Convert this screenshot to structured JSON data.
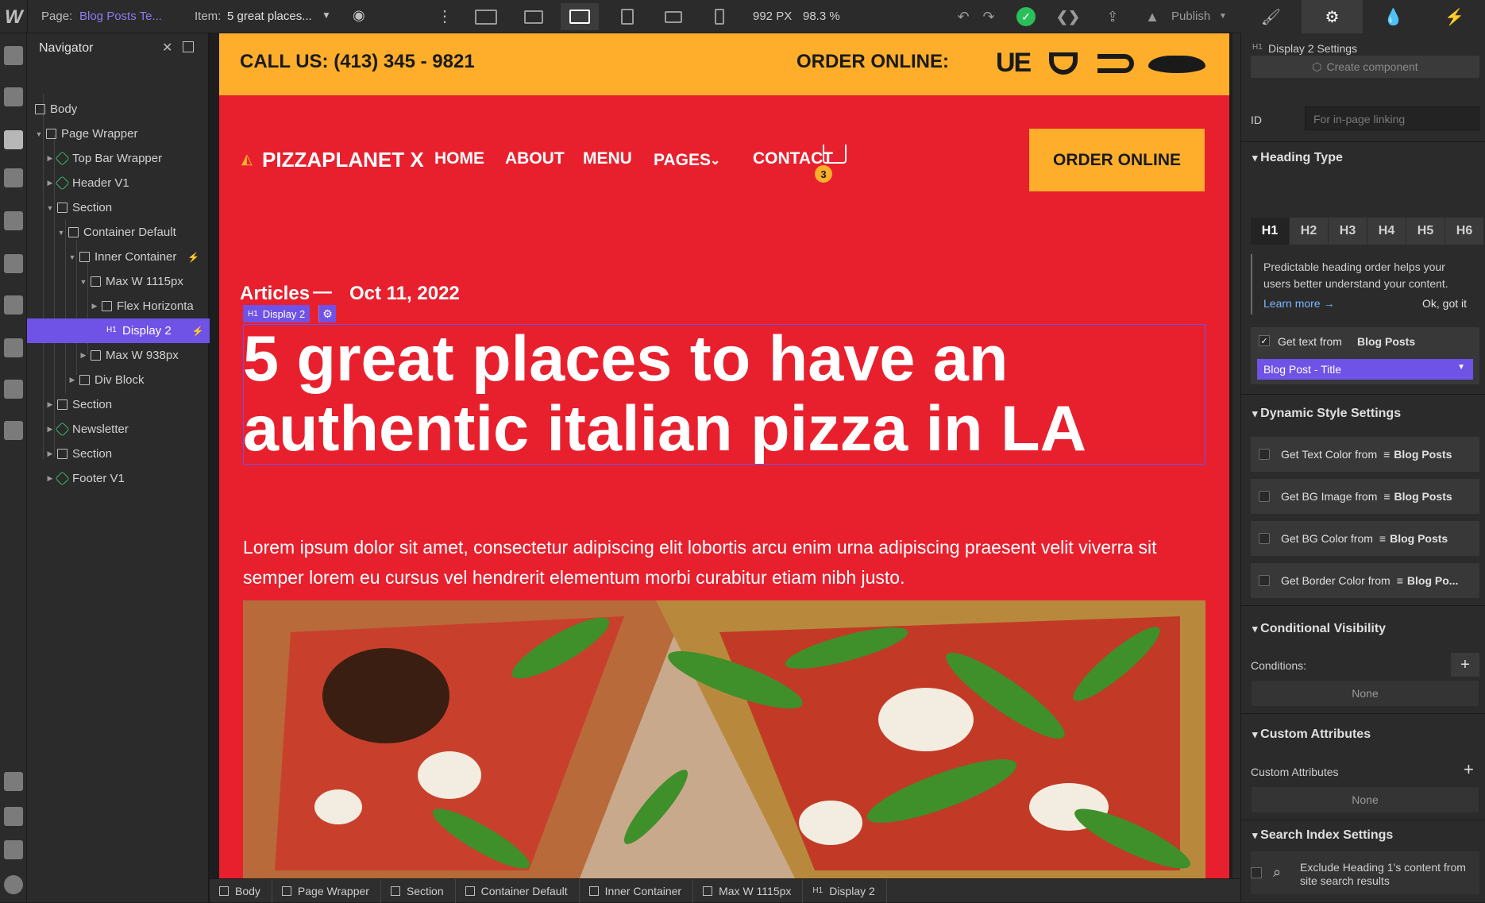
{
  "topbar": {
    "page_label": "Page:",
    "page_value": "Blog Posts Te...",
    "item_label": "Item:",
    "item_value": "5 great places...",
    "width": "992 PX",
    "zoom": "98.3 %",
    "publish": "Publish"
  },
  "navigator": {
    "title": "Navigator",
    "items": [
      {
        "label": "Body",
        "icon": "box"
      },
      {
        "label": "Page Wrapper",
        "icon": "box"
      },
      {
        "label": "Top Bar Wrapper",
        "icon": "symbol"
      },
      {
        "label": "Header V1",
        "icon": "symbol"
      },
      {
        "label": "Section",
        "icon": "section"
      },
      {
        "label": "Container Default",
        "icon": "container"
      },
      {
        "label": "Inner Container",
        "icon": "box"
      },
      {
        "label": "Max W 1115px",
        "icon": "box"
      },
      {
        "label": "Flex Horizonta",
        "icon": "box"
      },
      {
        "label": "Display 2",
        "icon": "H1"
      },
      {
        "label": "Max W 938px",
        "icon": "box"
      },
      {
        "label": "Div Block",
        "icon": "box"
      },
      {
        "label": "Section",
        "icon": "section"
      },
      {
        "label": "Newsletter",
        "icon": "symbol"
      },
      {
        "label": "Section",
        "icon": "section"
      },
      {
        "label": "Footer V1",
        "icon": "symbol"
      }
    ]
  },
  "site": {
    "call_us": "CALL US: (413) 345 - 9821",
    "order_online_label": "ORDER ONLINE:",
    "ue_logo": "UE",
    "brand": "PIZZAPLANET X",
    "nav": [
      "HOME",
      "ABOUT",
      "MENU",
      "PAGES",
      "CONTACT"
    ],
    "cart_count": "3",
    "order_button": "ORDER ONLINE",
    "category": "Articles",
    "dash": "—",
    "date": "Oct 11, 2022",
    "heading_tag": "H1",
    "heading_class": "Display 2",
    "headline": "5 great places to have an authentic italian pizza in LA",
    "paragraph": "Lorem ipsum dolor sit amet, consectetur adipiscing elit lobortis arcu enim urna adipiscing praesent velit viverra sit semper lorem eu cursus vel hendrerit elementum morbi curabitur etiam nibh justo."
  },
  "breadcrumbs": [
    "Body",
    "Page Wrapper",
    "Section",
    "Container Default",
    "Inner Container",
    "Max W 1115px",
    "Display 2"
  ],
  "settings": {
    "title_tag": "H1",
    "title": "Display 2 Settings",
    "create_component": "Create component",
    "id_label": "ID",
    "id_placeholder": "For in-page linking",
    "heading_type": "Heading Type",
    "heading_levels": [
      "H1",
      "H2",
      "H3",
      "H4",
      "H5",
      "H6"
    ],
    "tip_text": "Predictable heading order helps your users better understand your content.",
    "learn_more": "Learn more →",
    "ok_got_it": "Ok, got it",
    "get_text_from": "Get text from",
    "blog_posts": "Blog Posts",
    "field_value": "Blog Post - Title",
    "dynamic_style": "Dynamic Style Settings",
    "dynamic_rows": [
      {
        "label": "Get Text Color from",
        "source": "Blog Posts"
      },
      {
        "label": "Get BG Image from",
        "source": "Blog Posts"
      },
      {
        "label": "Get BG Color from",
        "source": "Blog Posts"
      },
      {
        "label": "Get Border Color from",
        "source": "Blog Po..."
      }
    ],
    "conditional_visibility": "Conditional Visibility",
    "conditions_label": "Conditions:",
    "conditions_value": "None",
    "custom_attributes": "Custom Attributes",
    "custom_attributes_label": "Custom Attributes",
    "custom_attributes_value": "None",
    "search_index": "Search Index Settings",
    "exclude_text": "Exclude Heading 1's content from site search results"
  }
}
